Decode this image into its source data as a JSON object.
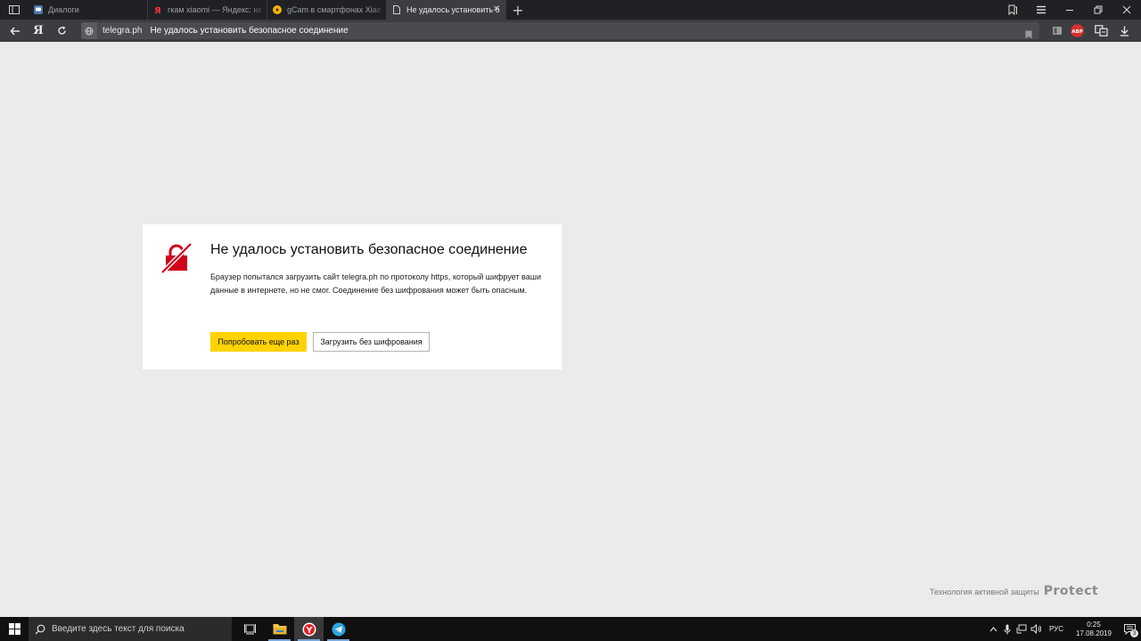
{
  "tabs": [
    {
      "label": "Диалоги",
      "icon": "vk-chat-icon",
      "active": false
    },
    {
      "label": "гкам xiaomi — Яндекс: нашлось",
      "icon": "yandex-icon",
      "active": false
    },
    {
      "label": "gCam в смартфонах Xiaomi",
      "icon": "play-icon",
      "active": false
    },
    {
      "label": "Не удалось установить безопасное соединение",
      "icon": "page-icon",
      "active": true
    }
  ],
  "toolbar": {
    "yandex_letter": "Я",
    "domain": "telegra.ph",
    "page_title": "Не удалось установить безопасное соединение",
    "abp_label": "ABP"
  },
  "error": {
    "title": "Не удалось установить безопасное соединение",
    "description": "Браузер попытался загрузить сайт telegra.ph по протоколу https, который шифрует ваши данные в интернете, но не смог. Соединение без шифрования может быть опасным.",
    "retry_button": "Попробовать еще раз",
    "load_unencrypted_button": "Загрузить без шифрования",
    "accent_color": "#ffd200",
    "icon_color": "#d0021b"
  },
  "protect": {
    "text": "Технология активной защиты",
    "logo": "Protect"
  },
  "taskbar": {
    "search_placeholder": "Введите здесь текст для поиска",
    "language": "РУС",
    "time": "0:25",
    "date": "17.08.2019",
    "notification_count": "3"
  }
}
